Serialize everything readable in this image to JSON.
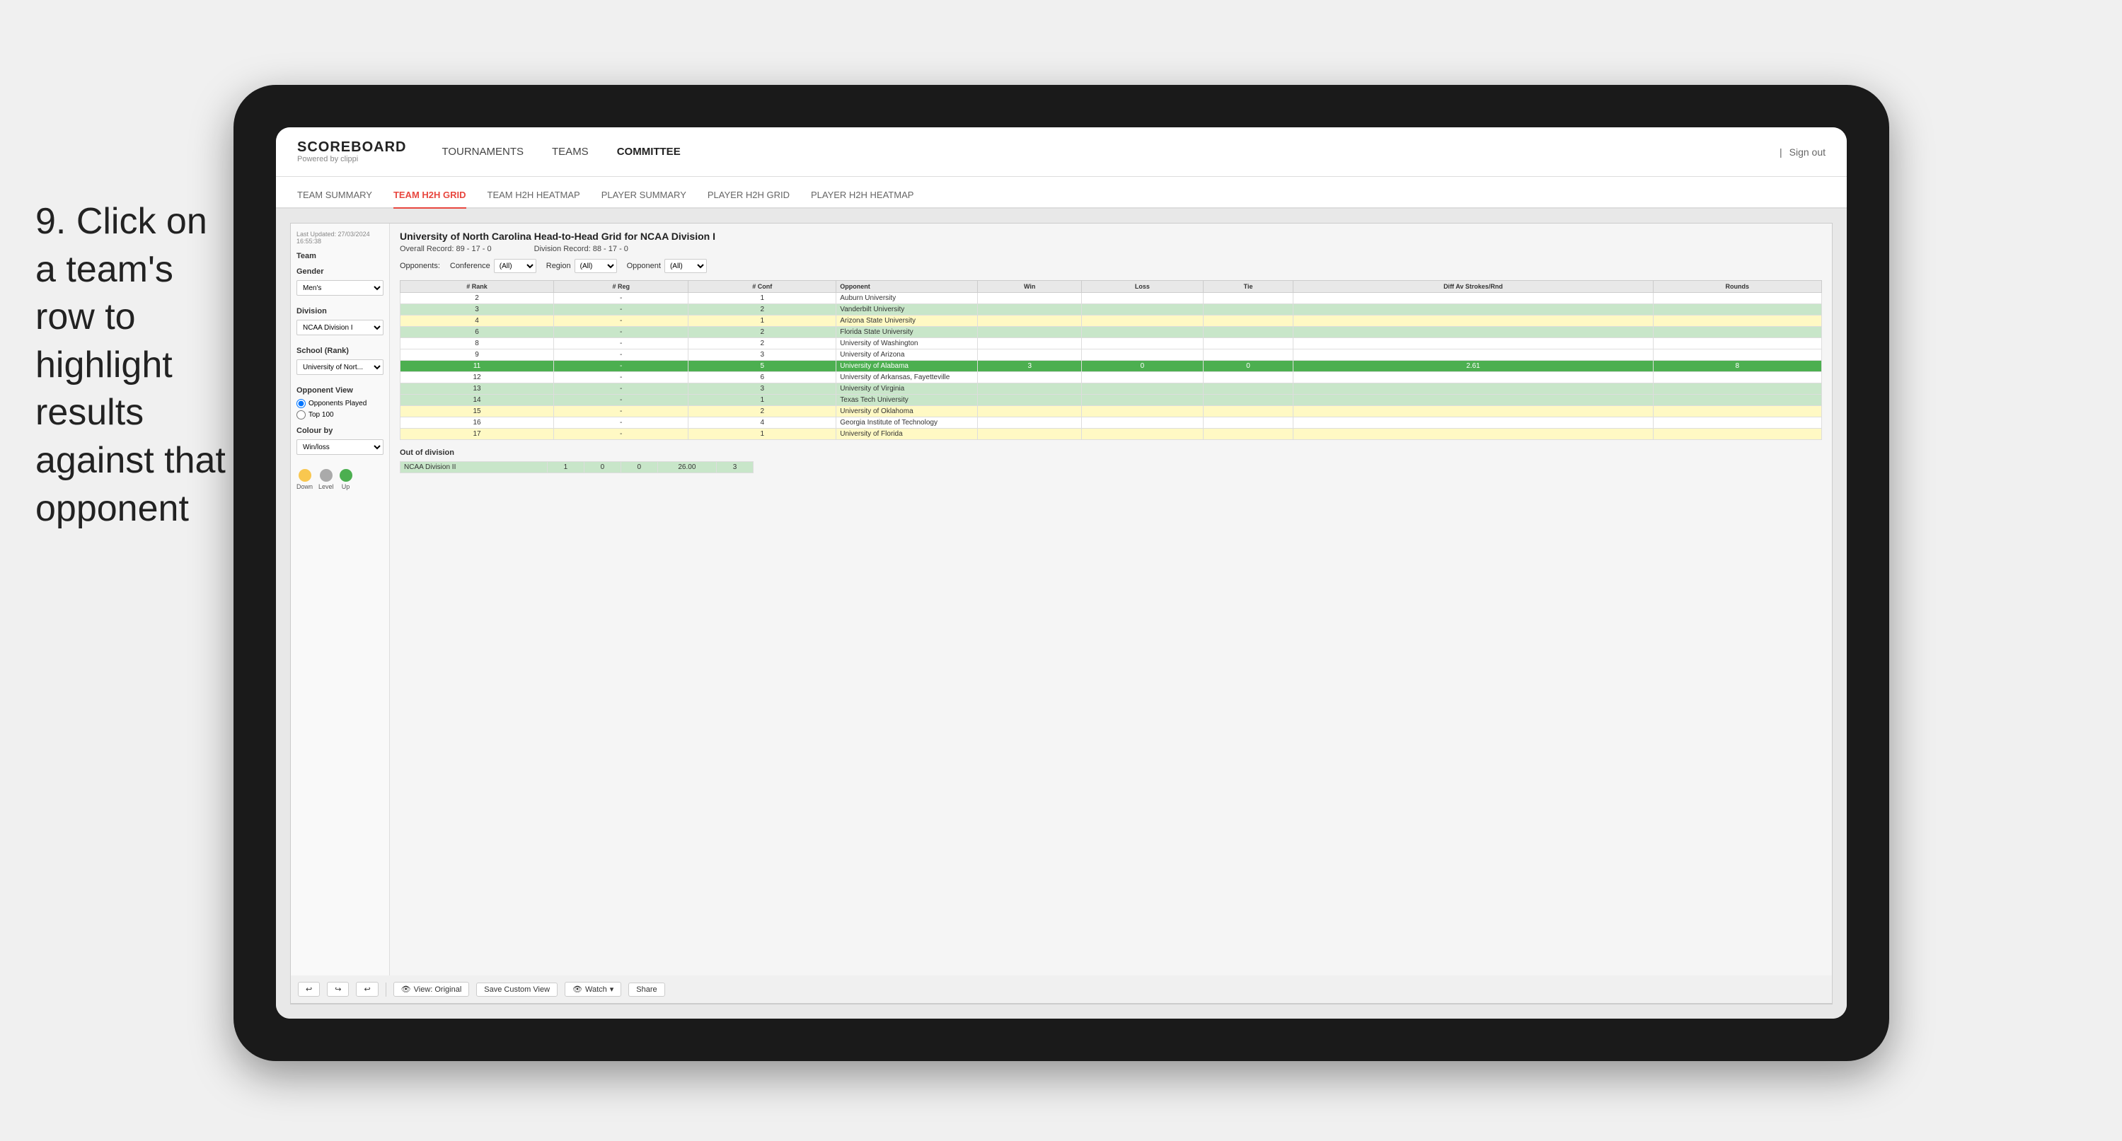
{
  "instruction": {
    "number": "9.",
    "text": "Click on a team's row to highlight results against that opponent"
  },
  "nav": {
    "logo": "SCOREBOARD",
    "logo_sub": "Powered by clippi",
    "links": [
      "TOURNAMENTS",
      "TEAMS",
      "COMMITTEE"
    ],
    "sign_out": "Sign out"
  },
  "sub_tabs": [
    {
      "label": "TEAM SUMMARY",
      "active": false
    },
    {
      "label": "TEAM H2H GRID",
      "active": true
    },
    {
      "label": "TEAM H2H HEATMAP",
      "active": false
    },
    {
      "label": "PLAYER SUMMARY",
      "active": false
    },
    {
      "label": "PLAYER H2H GRID",
      "active": false
    },
    {
      "label": "PLAYER H2H HEATMAP",
      "active": false
    }
  ],
  "left_panel": {
    "last_updated": "Last Updated: 27/03/2024",
    "time": "16:55:38",
    "team_label": "Team",
    "gender_label": "Gender",
    "gender_value": "Men's",
    "division_label": "Division",
    "division_value": "NCAA Division I",
    "school_label": "School (Rank)",
    "school_value": "University of Nort...",
    "opponent_view_label": "Opponent View",
    "radio_options": [
      "Opponents Played",
      "Top 100"
    ],
    "color_by_label": "Colour by",
    "color_by_value": "Win/loss",
    "legend": [
      {
        "label": "Down",
        "color": "#f9c74f"
      },
      {
        "label": "Level",
        "color": "#aaa"
      },
      {
        "label": "Up",
        "color": "#4caf50"
      }
    ]
  },
  "report": {
    "title": "University of North Carolina Head-to-Head Grid for NCAA Division I",
    "overall_record": "Overall Record: 89 - 17 - 0",
    "division_record": "Division Record: 88 - 17 - 0",
    "filters": {
      "opponents_label": "Opponents:",
      "conference_label": "Conference",
      "conference_value": "(All)",
      "region_label": "Region",
      "region_value": "(All)",
      "opponent_label": "Opponent",
      "opponent_value": "(All)"
    },
    "table_headers": [
      "# Rank",
      "# Reg",
      "# Conf",
      "Opponent",
      "Win",
      "Loss",
      "Tie",
      "Diff Av Strokes/Rnd",
      "Rounds"
    ],
    "rows": [
      {
        "rank": "2",
        "reg": "-",
        "conf": "1",
        "opponent": "Auburn University",
        "win": "",
        "loss": "",
        "tie": "",
        "diff": "",
        "rounds": "",
        "style": "normal"
      },
      {
        "rank": "3",
        "reg": "-",
        "conf": "2",
        "opponent": "Vanderbilt University",
        "win": "",
        "loss": "",
        "tie": "",
        "diff": "",
        "rounds": "",
        "style": "light-green"
      },
      {
        "rank": "4",
        "reg": "-",
        "conf": "1",
        "opponent": "Arizona State University",
        "win": "",
        "loss": "",
        "tie": "",
        "diff": "",
        "rounds": "",
        "style": "light-yellow"
      },
      {
        "rank": "6",
        "reg": "-",
        "conf": "2",
        "opponent": "Florida State University",
        "win": "",
        "loss": "",
        "tie": "",
        "diff": "",
        "rounds": "",
        "style": "light-green"
      },
      {
        "rank": "8",
        "reg": "-",
        "conf": "2",
        "opponent": "University of Washington",
        "win": "",
        "loss": "",
        "tie": "",
        "diff": "",
        "rounds": "",
        "style": "normal"
      },
      {
        "rank": "9",
        "reg": "-",
        "conf": "3",
        "opponent": "University of Arizona",
        "win": "",
        "loss": "",
        "tie": "",
        "diff": "",
        "rounds": "",
        "style": "normal"
      },
      {
        "rank": "11",
        "reg": "-",
        "conf": "5",
        "opponent": "University of Alabama",
        "win": "3",
        "loss": "0",
        "tie": "0",
        "diff": "2.61",
        "rounds": "8",
        "style": "selected"
      },
      {
        "rank": "12",
        "reg": "-",
        "conf": "6",
        "opponent": "University of Arkansas, Fayetteville",
        "win": "",
        "loss": "",
        "tie": "",
        "diff": "",
        "rounds": "",
        "style": "normal"
      },
      {
        "rank": "13",
        "reg": "-",
        "conf": "3",
        "opponent": "University of Virginia",
        "win": "",
        "loss": "",
        "tie": "",
        "diff": "",
        "rounds": "",
        "style": "light-green"
      },
      {
        "rank": "14",
        "reg": "-",
        "conf": "1",
        "opponent": "Texas Tech University",
        "win": "",
        "loss": "",
        "tie": "",
        "diff": "",
        "rounds": "",
        "style": "light-green"
      },
      {
        "rank": "15",
        "reg": "-",
        "conf": "2",
        "opponent": "University of Oklahoma",
        "win": "",
        "loss": "",
        "tie": "",
        "diff": "",
        "rounds": "",
        "style": "light-yellow"
      },
      {
        "rank": "16",
        "reg": "-",
        "conf": "4",
        "opponent": "Georgia Institute of Technology",
        "win": "",
        "loss": "",
        "tie": "",
        "diff": "",
        "rounds": "",
        "style": "normal"
      },
      {
        "rank": "17",
        "reg": "-",
        "conf": "1",
        "opponent": "University of Florida",
        "win": "",
        "loss": "",
        "tie": "",
        "diff": "",
        "rounds": "",
        "style": "light-yellow"
      }
    ],
    "out_of_division_label": "Out of division",
    "out_of_division_rows": [
      {
        "division": "NCAA Division II",
        "win": "1",
        "loss": "0",
        "tie": "0",
        "diff": "26.00",
        "rounds": "3",
        "style": "out-div"
      }
    ]
  },
  "toolbar": {
    "view_label": "View: Original",
    "save_custom": "Save Custom View",
    "watch": "Watch",
    "share": "Share"
  }
}
